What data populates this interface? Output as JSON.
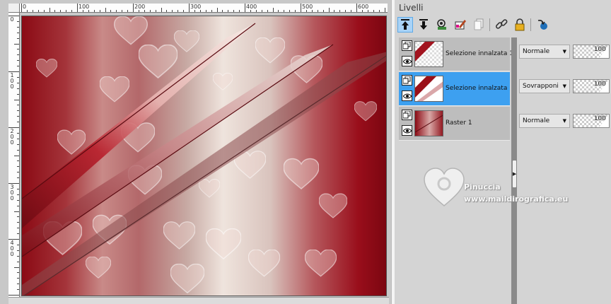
{
  "ruler": {
    "top_labels": [
      "0",
      "100",
      "200",
      "300",
      "400",
      "500",
      "600"
    ],
    "left_labels": [
      "0",
      "1\n0\n0",
      "2\n0\n0",
      "3\n0\n0",
      "4\n0\n0"
    ]
  },
  "layers_panel": {
    "title": "Livelli",
    "toolbar": [
      {
        "icon": "new-layer-up-icon",
        "active": true
      },
      {
        "icon": "new-layer-down-icon",
        "active": false
      },
      {
        "icon": "mask-icon",
        "active": false
      },
      {
        "icon": "brush-layer-icon",
        "active": false
      },
      {
        "icon": "duplicate-layer-icon",
        "active": false
      },
      {
        "icon": "link-icon",
        "active": false
      },
      {
        "icon": "lock-icon",
        "active": false
      },
      {
        "icon": "refresh-icon",
        "active": false
      }
    ],
    "layers": [
      {
        "name": "Selezione innalzata 1",
        "blend_mode": "Normale",
        "opacity": "100",
        "selected": false
      },
      {
        "name": "Selezione innalzata",
        "blend_mode": "Sovrapponi",
        "opacity": "100",
        "selected": true
      },
      {
        "name": "Raster 1",
        "blend_mode": "Normale",
        "opacity": "100",
        "selected": false
      }
    ]
  },
  "watermark": {
    "name": "Pinuccia",
    "site": "www.maildirografica.eu"
  },
  "colors": {
    "selected_row": "#3da0f0",
    "crimson": "#8b0a14",
    "cream": "#f0e4de"
  }
}
